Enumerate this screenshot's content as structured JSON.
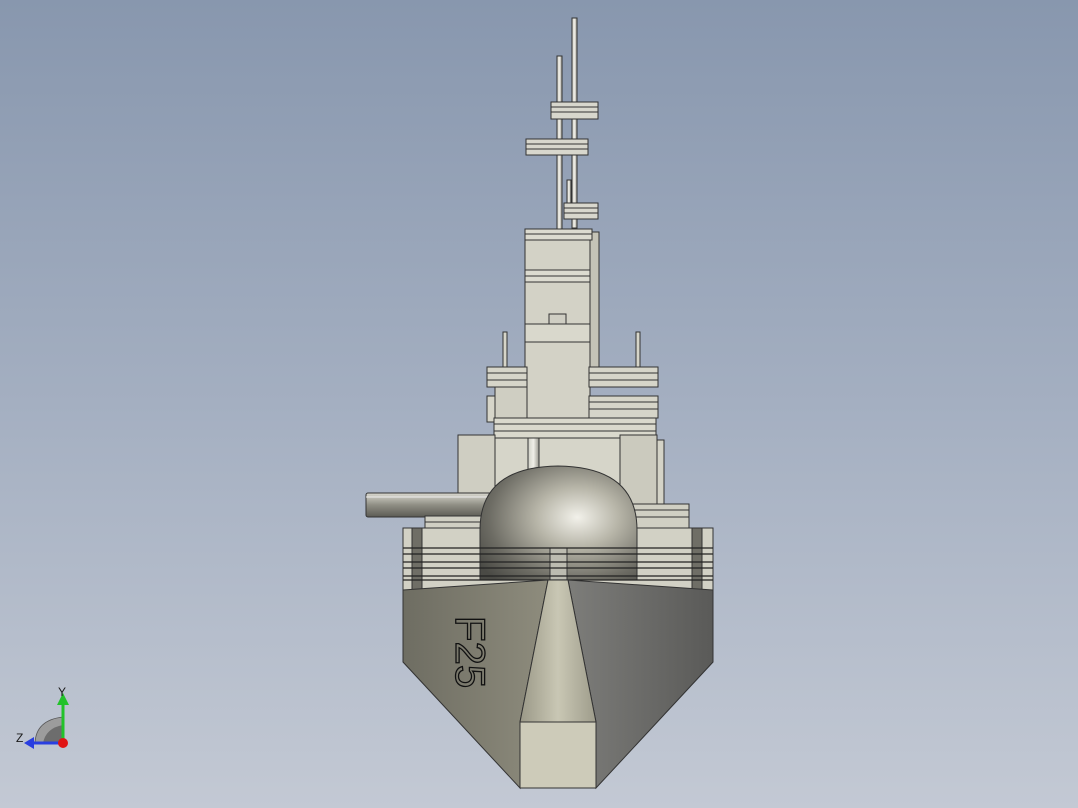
{
  "viewport": {
    "model_label": "F25",
    "background_top": "#8897ae",
    "background_bottom": "#c3c9d4"
  },
  "triad": {
    "y_label": "Y",
    "z_label": "Z",
    "y_color": "#22c22a",
    "z_color": "#2a3fe0",
    "x_color": "#e01414"
  }
}
